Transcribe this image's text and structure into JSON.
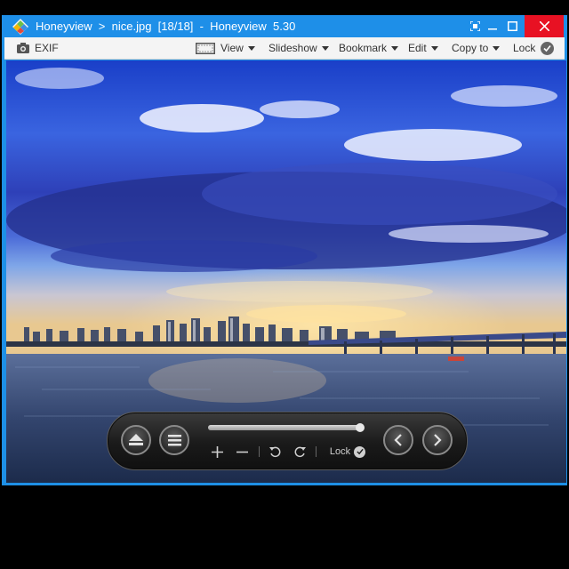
{
  "window": {
    "title": "Honeyview  >  nice.jpg  [18/18]  -  Honeyview  5.30",
    "accent": "#1e8fe8",
    "close_color": "#e81123"
  },
  "toolbar": {
    "exif_label": "EXIF",
    "view_label": "View",
    "slideshow_label": "Slideshow",
    "bookmark_label": "Bookmark",
    "edit_label": "Edit",
    "copyto_label": "Copy to",
    "lock_label": "Lock"
  },
  "viewer": {
    "image_description_icon": "photo-river-city-skyline"
  },
  "osd": {
    "progress": 0.97,
    "lock_label": "Lock"
  }
}
